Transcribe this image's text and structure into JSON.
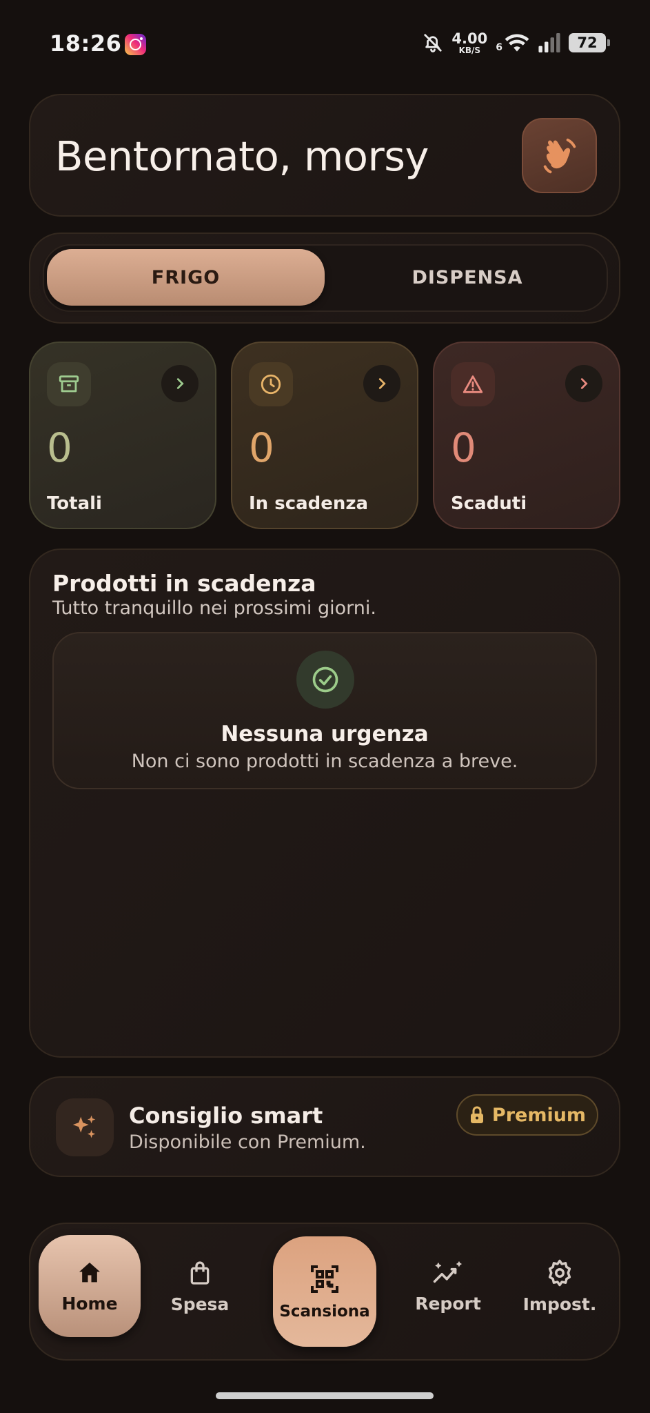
{
  "status_bar": {
    "time": "18:26",
    "speed_value": "4.00",
    "speed_unit": "KB/S",
    "wifi_label": "6",
    "battery": "72",
    "icons": [
      "instagram-icon",
      "bell-muted-icon",
      "wifi-icon",
      "signal-icon",
      "battery-icon"
    ]
  },
  "header": {
    "welcome_title": "Bentornato, morsy",
    "wave_icon": "waving-hand-icon"
  },
  "segmented": {
    "active": "FRIGO",
    "inactive": "DISPENSA"
  },
  "stats": [
    {
      "label": "Totali",
      "value": "0",
      "icon": "archive-box-icon",
      "color": "#9ecb8f"
    },
    {
      "label": "In scadenza",
      "value": "0",
      "icon": "clock-icon",
      "color": "#e8b469"
    },
    {
      "label": "Scaduti",
      "value": "0",
      "icon": "warning-icon",
      "color": "#e98b80"
    }
  ],
  "expiring": {
    "title": "Prodotti in scadenza",
    "subtitle": "Tutto tranquillo nei prossimi giorni.",
    "empty_title": "Nessuna urgenza",
    "empty_subtitle": "Non ci sono prodotti in scadenza a breve.",
    "empty_icon": "check-circle-icon"
  },
  "smart_tip": {
    "title": "Consiglio smart",
    "subtitle": "Disponibile con Premium.",
    "badge": "Premium",
    "icon": "sparkles-icon",
    "badge_icon": "lock-icon"
  },
  "nav": {
    "items": [
      {
        "label": "Home",
        "icon": "home-icon"
      },
      {
        "label": "Spesa",
        "icon": "shopping-bag-icon"
      },
      {
        "label": "Scansiona",
        "icon": "qr-scan-icon"
      },
      {
        "label": "Report",
        "icon": "trend-sparkle-icon"
      },
      {
        "label": "Impost.",
        "icon": "gear-icon"
      }
    ]
  },
  "colors": {
    "background": "#15100e",
    "accent": "#dca27f",
    "premium": "#e5b865"
  }
}
